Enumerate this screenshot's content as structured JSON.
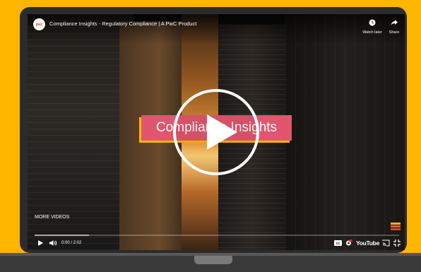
{
  "player": {
    "title": "Compliance Insights - Regulatory Compliance | A PwC Product",
    "channel_logo_text": "pwc",
    "watch_later_label": "Watch later",
    "share_label": "Share",
    "title_card_text": "Compliance Insights",
    "more_videos_label": "MORE VIDEOS",
    "time": "0:00 / 2:02",
    "youtube_label": "YouTube",
    "progress_fraction": 0.15
  },
  "colors": {
    "background": "#FFB600",
    "title_card": "#E0566E",
    "laptop_bezel": "#2b2b2b"
  },
  "icons": [
    "clock-icon",
    "share-icon",
    "play-icon",
    "volume-icon",
    "cc-icon",
    "settings-icon",
    "cast-icon",
    "fullscreen-icon"
  ]
}
